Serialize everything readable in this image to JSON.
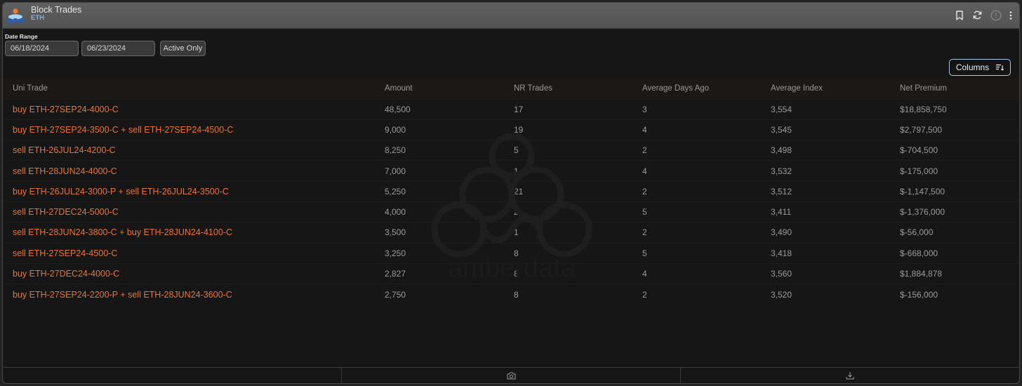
{
  "window": {
    "title": "Block Trades",
    "subtitle": "ETH",
    "icons": [
      "bookmark-icon",
      "refresh-icon",
      "info-icon",
      "more-vertical-icon"
    ]
  },
  "filters": {
    "date_range_label": "Date Range",
    "date_from": "06/18/2024",
    "date_to": "06/23/2024",
    "active_only_label": "Active Only"
  },
  "toolbar": {
    "columns_label": "Columns",
    "columns_icon": "sort-lines-icon"
  },
  "colors": {
    "trade_link": "#e9743a",
    "accent_border": "#a9c8e8",
    "subtitle": "#7fb6ea"
  },
  "table": {
    "headers": [
      "Uni Trade",
      "Amount",
      "NR Trades",
      "Average Days Ago",
      "Average Index",
      "Net Premium"
    ],
    "rows": [
      [
        "buy ETH-27SEP24-4000-C",
        "48,500",
        "17",
        "3",
        "3,554",
        "$18,858,750"
      ],
      [
        "buy ETH-27SEP24-3500-C + sell ETH-27SEP24-4500-C",
        "9,000",
        "19",
        "4",
        "3,545",
        "$2,797,500"
      ],
      [
        "sell ETH-26JUL24-4200-C",
        "8,250",
        "5",
        "2",
        "3,498",
        "$-704,500"
      ],
      [
        "sell ETH-28JUN24-4000-C",
        "7,000",
        "1",
        "4",
        "3,532",
        "$-175,000"
      ],
      [
        "buy ETH-26JUL24-3000-P + sell ETH-26JUL24-3500-C",
        "5,250",
        "21",
        "2",
        "3,512",
        "$-1,147,500"
      ],
      [
        "sell ETH-27DEC24-5000-C",
        "4,000",
        "2",
        "5",
        "3,411",
        "$-1,376,000"
      ],
      [
        "sell ETH-28JUN24-3800-C + buy ETH-28JUN24-4100-C",
        "3,500",
        "1",
        "2",
        "3,490",
        "$-56,000"
      ],
      [
        "sell ETH-27SEP24-4500-C",
        "3,250",
        "8",
        "5",
        "3,418",
        "$-668,000"
      ],
      [
        "buy ETH-27DEC24-4000-C",
        "2,827",
        "8",
        "4",
        "3,560",
        "$1,884,878"
      ],
      [
        "buy ETH-27SEP24-2200-P + sell ETH-28JUN24-3600-C",
        "2,750",
        "8",
        "2",
        "3,520",
        "$-156,000"
      ]
    ]
  },
  "watermark": {
    "text": "amberdata"
  },
  "footer": {
    "icons": [
      "camera-icon",
      "download-icon"
    ]
  }
}
